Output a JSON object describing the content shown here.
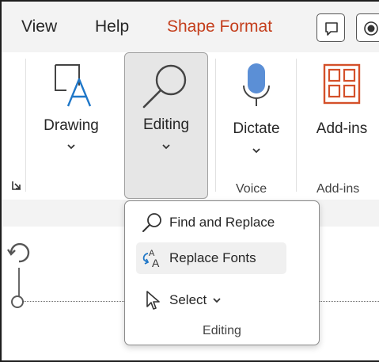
{
  "menu": {
    "tabs": [
      {
        "label": "View"
      },
      {
        "label": "Help"
      },
      {
        "label": "Shape Format"
      }
    ],
    "active_color": "#c43e1c"
  },
  "ribbon": {
    "buttons": {
      "drawing": {
        "label": "Drawing",
        "icon": "drawing-shape-icon"
      },
      "editing": {
        "label": "Editing",
        "icon": "magnifier-icon",
        "state": "pressed"
      },
      "dictate": {
        "label": "Dictate",
        "icon": "microphone-icon"
      },
      "addins": {
        "label": "Add-ins",
        "icon": "addins-grid-icon"
      }
    },
    "groups": {
      "voice": "Voice",
      "addins": "Add-ins"
    }
  },
  "dropdown": {
    "items": [
      {
        "label": "Find and Replace",
        "icon": "search-icon"
      },
      {
        "label": "Replace Fonts",
        "icon": "replace-fonts-icon"
      },
      {
        "label": "Select",
        "icon": "pointer-icon",
        "has_submenu": true
      }
    ],
    "footer": "Editing"
  },
  "colors": {
    "mic": "#5b8fd6",
    "addins": "#d4502a",
    "drawing_accent": "#1f77c8"
  }
}
